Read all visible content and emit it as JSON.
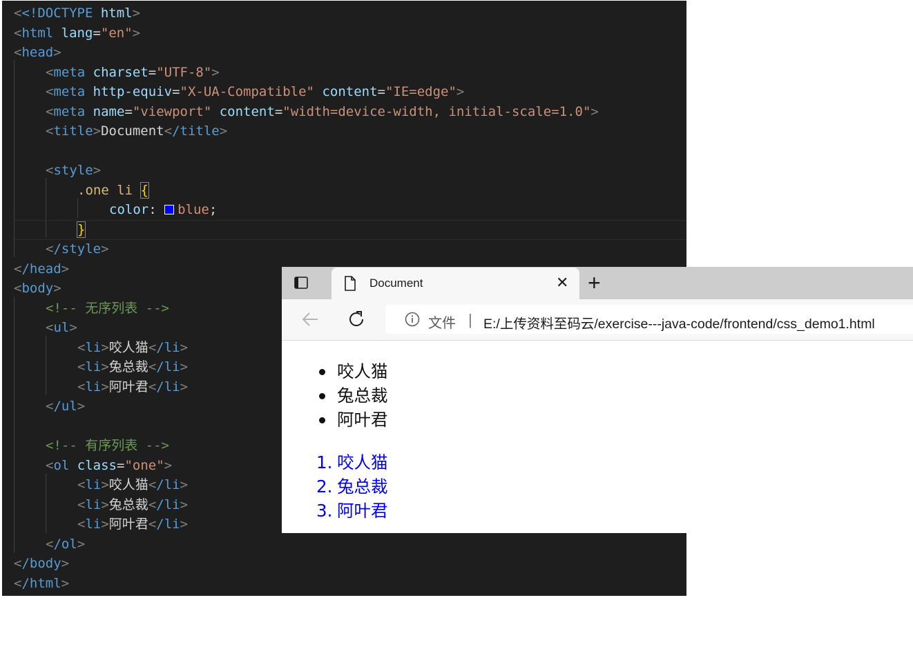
{
  "editor": {
    "comment_ul": "<!-- 无序列表 -->",
    "comment_ol": "<!-- 有序列表 -->",
    "swatch_color": "#0000ff",
    "code": {
      "doctype": "<!DOCTYPE",
      "html": "html",
      "html_close": "/html",
      "lang_attr": "lang",
      "lang_val": "\"en\"",
      "head": "head",
      "head_close": "/head",
      "meta": "meta",
      "charset_attr": "charset",
      "charset_val": "\"UTF-8\"",
      "httpequiv_attr": "http-equiv",
      "httpequiv_val": "\"X-UA-Compatible\"",
      "content_attr": "content",
      "content_val1": "\"IE=edge\"",
      "name_attr": "name",
      "name_val": "\"viewport\"",
      "content_val2": "\"width=device-width, initial-scale=1.0\"",
      "title": "title",
      "title_close": "/title",
      "title_text": "Document",
      "style": "style",
      "style_close": "/style",
      "selector": ".one li",
      "open_brace": "{",
      "close_brace": "}",
      "prop": "color",
      "colon": ": ",
      "value": "blue",
      "semi": ";",
      "body": "body",
      "body_close": "/body",
      "ul": "ul",
      "ul_close": "/ul",
      "ol": "ol",
      "ol_close": "/ol",
      "class_attr": "class",
      "class_val": "\"one\"",
      "li": "li",
      "li_close": "/li",
      "item1": "咬人猫",
      "item2": "兔总裁",
      "item3": "阿叶君"
    }
  },
  "browser": {
    "tab_title": "Document",
    "new_tab": "+",
    "close": "✕",
    "address_label": "文件",
    "address_sep": "|",
    "url": "E:/上传资料至码云/exercise---java-code/frontend/css_demo1.html",
    "ul_items": [
      "咬人猫",
      "兔总裁",
      "阿叶君"
    ],
    "ol_items": [
      "咬人猫",
      "兔总裁",
      "阿叶君"
    ],
    "ol_numbers": [
      "1.",
      "2.",
      "3."
    ],
    "ol_color": "#0000ff"
  }
}
